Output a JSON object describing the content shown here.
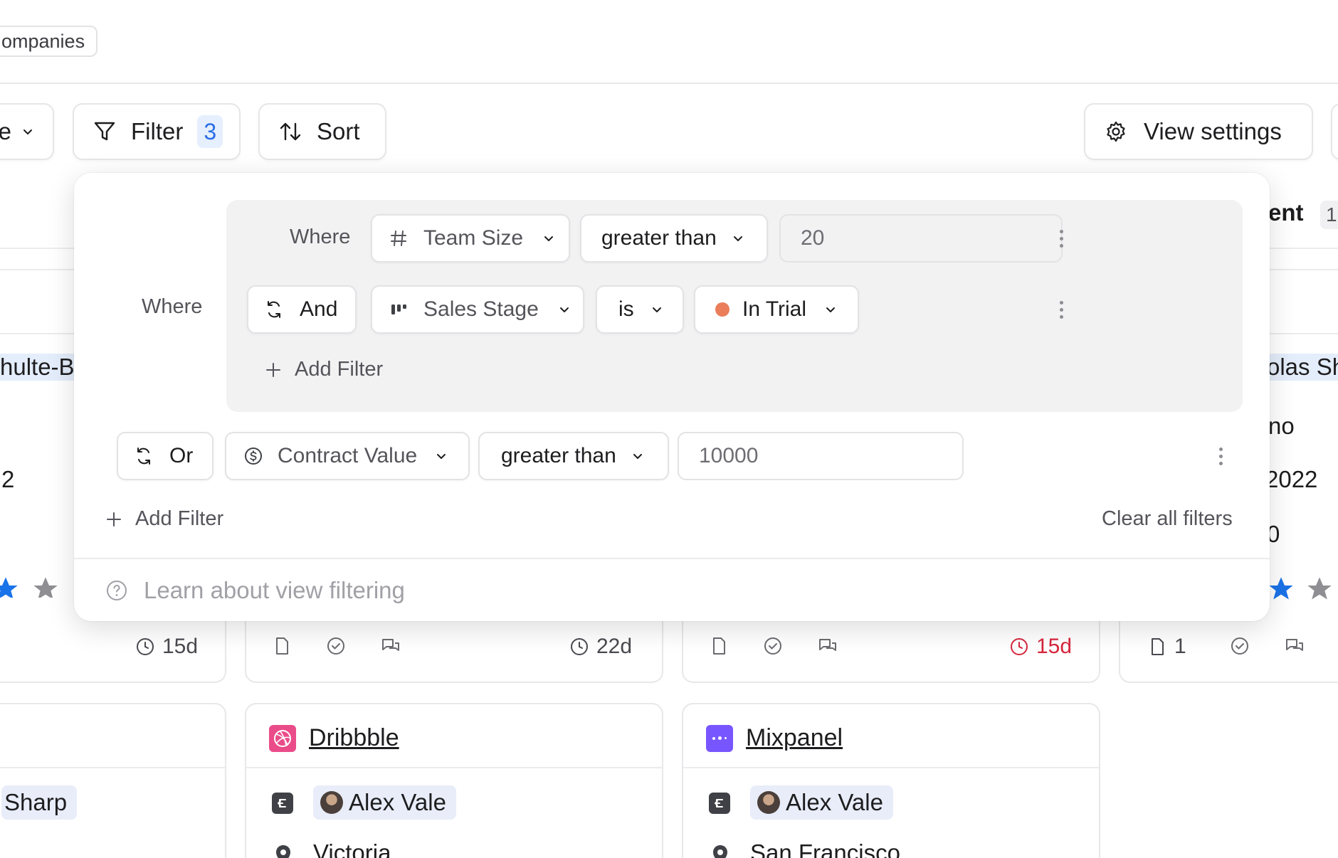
{
  "header": {
    "breadcrumb_chip": "ompanies"
  },
  "toolbar": {
    "view_label": "e",
    "filter_label": "Filter",
    "filter_count": "3",
    "sort_label": "Sort",
    "view_settings_label": "View settings"
  },
  "board": {
    "right_column_header": "ent",
    "right_column_count": "1",
    "left_card": {
      "name_fragment": "hulte-B",
      "value_fragment": "2",
      "age": "15d",
      "owner_fragment": "Sharp"
    },
    "right_card": {
      "name_fragment": "olas Sh",
      "line1": "no",
      "line2": "2022",
      "line3": "0",
      "files": "1"
    },
    "middle_card": {
      "age": "22d"
    },
    "third_card": {
      "age": "15d"
    },
    "cards": [
      {
        "name": "Dribbble",
        "owner": "Alex Vale",
        "location": "Victoria"
      },
      {
        "name": "Mixpanel",
        "owner": "Alex Vale",
        "location": "San Francisco"
      }
    ],
    "colors": {
      "star_active": "#1a73e8",
      "star_inactive": "#8e8e93",
      "overdue": "#d7263d",
      "dribbble": "#ea4c89",
      "mixpanel": "#7856ff"
    }
  },
  "filter_panel": {
    "outer_where": "Where",
    "group": {
      "where_label": "Where",
      "rule1": {
        "field": "Team Size",
        "field_icon": "hash-icon",
        "operator": "greater than",
        "value": "20"
      },
      "rule2": {
        "connector": "And",
        "field": "Sales Stage",
        "field_icon": "kanban-icon",
        "operator": "is",
        "value": "In Trial",
        "value_color": "#ea7d5a"
      },
      "add_filter": "Add Filter"
    },
    "rule3": {
      "connector": "Or",
      "field": "Contract Value",
      "field_icon": "currency-icon",
      "operator": "greater than",
      "value": "10000"
    },
    "add_filter": "Add Filter",
    "clear_all": "Clear all filters",
    "learn_link": "Learn about view filtering"
  }
}
